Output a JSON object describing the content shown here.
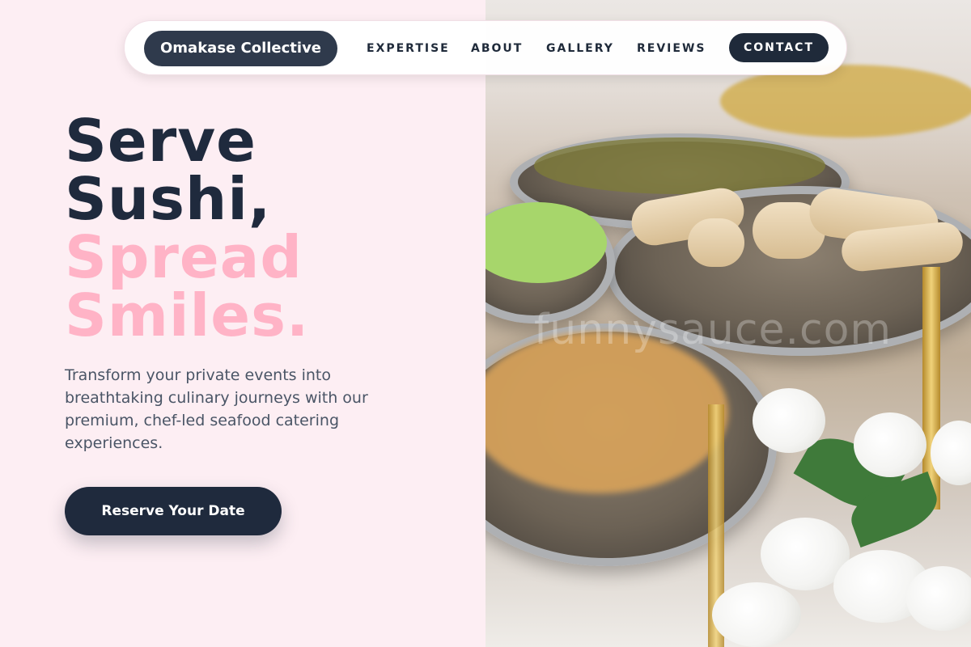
{
  "nav": {
    "brand": "Omakase Collective",
    "links": [
      "EXPERTISE",
      "ABOUT",
      "GALLERY",
      "REVIEWS"
    ],
    "contact_label": "CONTACT"
  },
  "hero": {
    "title_line1": "Serve",
    "title_line2": "Sushi,",
    "title_line3": "Spread",
    "title_line4": "Smiles.",
    "subtitle": "Transform your private events into breathtaking culinary journeys with our premium, chef-led seafood catering experiences.",
    "cta_label": "Reserve Your Date"
  },
  "watermark": "funnysauce.com",
  "colors": {
    "background": "#fdeef3",
    "navy": "#1f2a3d",
    "pink_accent": "#ffb3c6",
    "brand_pill": "#2f3a4c"
  }
}
